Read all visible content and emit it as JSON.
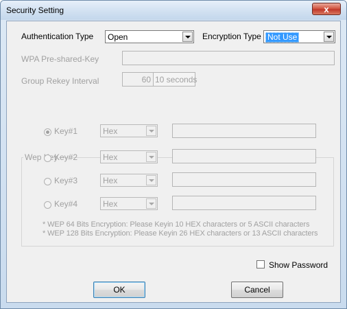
{
  "window": {
    "title": "Security Setting",
    "close_label": "x"
  },
  "auth": {
    "label": "Authentication Type",
    "value": "Open"
  },
  "encryption": {
    "label": "Encryption Type",
    "value": "Not Use"
  },
  "wpa": {
    "label": "WPA Pre-shared-Key",
    "value": ""
  },
  "rekey": {
    "label": "Group Rekey Interval",
    "value": "60",
    "unit": "10 seconds"
  },
  "wep": {
    "legend": "Wep Key",
    "keys": [
      {
        "label": "Key#1",
        "format": "Hex",
        "value": "",
        "selected": true
      },
      {
        "label": "Key#2",
        "format": "Hex",
        "value": "",
        "selected": false
      },
      {
        "label": "Key#3",
        "format": "Hex",
        "value": "",
        "selected": false
      },
      {
        "label": "Key#4",
        "format": "Hex",
        "value": "",
        "selected": false
      }
    ],
    "notes": [
      "* WEP 64 Bits Encryption:  Please Keyin 10 HEX characters or 5 ASCII characters",
      "* WEP 128 Bits Encryption:  Please Keyin 26 HEX characters or 13 ASCII characters"
    ]
  },
  "show_password": {
    "label": "Show Password",
    "checked": false
  },
  "buttons": {
    "ok": "OK",
    "cancel": "Cancel"
  }
}
